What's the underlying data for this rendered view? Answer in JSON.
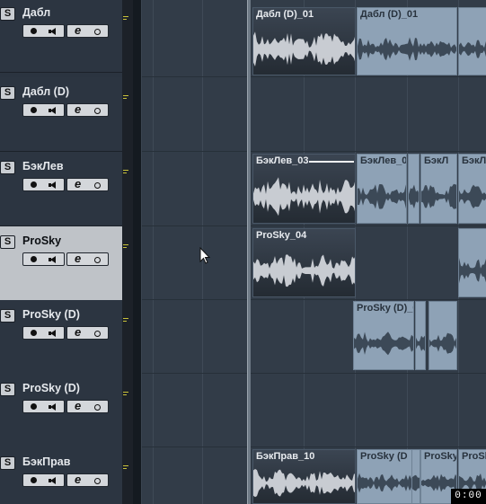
{
  "tracks": [
    {
      "name": "Дабл",
      "selected": false,
      "solo_label": "S"
    },
    {
      "name": "Дабл (D)",
      "selected": false,
      "solo_label": "S"
    },
    {
      "name": "БэкЛев",
      "selected": false,
      "solo_label": "S"
    },
    {
      "name": "ProSky",
      "selected": true,
      "solo_label": "S"
    },
    {
      "name": "ProSky (D)",
      "selected": false,
      "solo_label": "S"
    },
    {
      "name": "ProSky (D)",
      "selected": false,
      "solo_label": "S"
    },
    {
      "name": "БэкПрав",
      "selected": false,
      "solo_label": "S"
    }
  ],
  "track_controls": {
    "edit_glyph": "e"
  },
  "events": [
    {
      "label": "Дабл (D)_01",
      "style": "dark"
    },
    {
      "label": "Дабл (D)_01",
      "style": "light"
    },
    {
      "label": "",
      "style": "light"
    },
    {
      "label": "БэкЛев_03",
      "style": "dark"
    },
    {
      "label": "БэкЛев_0",
      "style": "light"
    },
    {
      "label": "",
      "style": "light"
    },
    {
      "label": "БэкЛ",
      "style": "light"
    },
    {
      "label": "БэкЛ",
      "style": "light"
    },
    {
      "label": "ProSky_04",
      "style": "dark"
    },
    {
      "label": "",
      "style": "light"
    },
    {
      "label": "ProSky (D)_0",
      "style": "light"
    },
    {
      "label": "",
      "style": "light"
    },
    {
      "label": "",
      "style": "light"
    },
    {
      "label": "БэкПрав_10",
      "style": "dark"
    },
    {
      "label": "ProSky (D",
      "style": "light"
    },
    {
      "label": "",
      "style": "light"
    },
    {
      "label": "ProSky",
      "style": "light"
    },
    {
      "label": "ProSk",
      "style": "light"
    }
  ],
  "timecode": "0:00",
  "colors": {
    "selected_track": "#bfc3c8",
    "event_dark": "#2c343e",
    "event_light": "#8ea2b6",
    "meter_tick": "#c9c23a"
  }
}
